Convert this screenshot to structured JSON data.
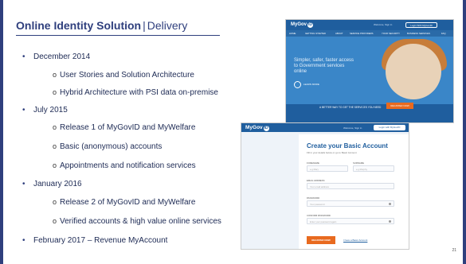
{
  "slide": {
    "title_bold": "Online Identity Solution",
    "title_sep": "|",
    "title_light": "Delivery",
    "page_number": "21"
  },
  "bullets": [
    {
      "level": 1,
      "text": "December 2014"
    },
    {
      "level": 2,
      "text": "User Stories and Solution Architecture"
    },
    {
      "level": 2,
      "text": "Hybrid Architecture with PSI data on-premise"
    },
    {
      "level": 1,
      "text": "July 2015"
    },
    {
      "level": 2,
      "text": "Release 1 of MyGovID and MyWelfare"
    },
    {
      "level": 2,
      "text": "Basic (anonymous) accounts"
    },
    {
      "level": 2,
      "text": "Appointments and notification services"
    },
    {
      "level": 1,
      "text": "January 2016"
    },
    {
      "level": 2,
      "text": "Release 2 of MyGovID and MyWelfare"
    },
    {
      "level": 2,
      "text": "Verified accounts & high value online services"
    },
    {
      "level": 1,
      "text": "February 2017 – Revenue MyAccount"
    }
  ],
  "bullet_glyphs": {
    "level1": "•",
    "level2": "o"
  },
  "screenshot_home": {
    "logo_text": "MyGov",
    "logo_badge": "ID",
    "signed_in_text": "Welcome, Sign in",
    "login_button": "Login With MyGovID",
    "nav": [
      "HOME",
      "GETTING STARTED",
      "ABOUT",
      "SERVICE PROVIDERS",
      "YOUR SECURITY",
      "BUSINESS SERVICES",
      "FAQ"
    ],
    "hero_text": "Simpler, safer, faster access to Government services online",
    "learn_more": "LEARN MORE",
    "better_way": "A BETTER WAY TO GET THE SERVICES YOU NEED",
    "register_button": "REGISTER NOW"
  },
  "screenshot_register": {
    "logo_text": "MyGov",
    "logo_badge": "ID",
    "signed_in_text": "Welcome, Sign in",
    "login_button": "Login with MyGovID",
    "heading": "Create your Basic Account",
    "subheading": "Fill in your details below or go to Basic Account",
    "fields": {
      "forename_label": "FORENAME",
      "forename_placeholder": "e.g Mary",
      "surname_label": "SURNAME",
      "surname_placeholder": "e.g Murphy",
      "email_label": "EMAIL ADDRESS",
      "email_placeholder": "Your email address",
      "password_label": "PASSWORD",
      "password_placeholder": "Your password",
      "confirm_label": "CONFIRM PASSWORD",
      "confirm_placeholder": "Enter your password again"
    },
    "register_button": "REGISTER NOW",
    "link_text": "I have a Basic Account"
  },
  "colors": {
    "brand_navy": "#2f3f7d",
    "mygov_blue": "#1f5e9e",
    "register_orange": "#e86a1f"
  }
}
